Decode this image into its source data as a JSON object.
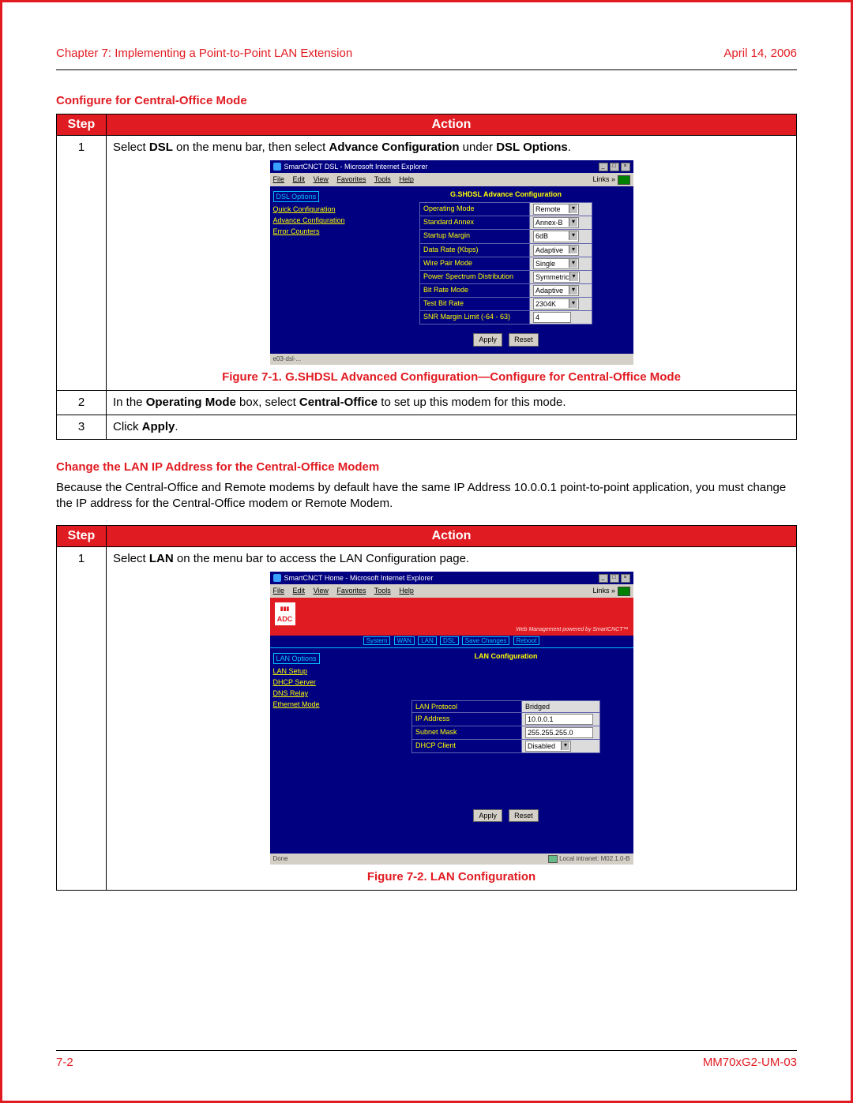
{
  "header": {
    "chapter": "Chapter 7: Implementing a Point-to-Point LAN Extension",
    "date": "April 14, 2006"
  },
  "section1": {
    "heading": "Configure for Central-Office Mode",
    "table_headers": {
      "step": "Step",
      "action": "Action"
    },
    "rows": [
      {
        "num": "1",
        "pre": "Select ",
        "b1": "DSL",
        "mid1": " on the menu bar, then select ",
        "b2": "Advance Configuration",
        "mid2": " under ",
        "b3": "DSL Options",
        "post": "."
      },
      {
        "num": "2",
        "pre": "In the ",
        "b1": "Operating Mode",
        "mid1": " box, select ",
        "b2": "Central-Office",
        "post": " to set up this modem for this mode."
      },
      {
        "num": "3",
        "pre": "Click ",
        "b1": "Apply",
        "post": "."
      }
    ],
    "figure_caption": "Figure 7-1. G.SHDSL Advanced Configuration—Configure for Central-Office Mode"
  },
  "embed1": {
    "title": "SmartCNCT DSL - Microsoft Internet Explorer",
    "menus": {
      "file": "File",
      "edit": "Edit",
      "view": "View",
      "favorites": "Favorites",
      "tools": "Tools",
      "help": "Help"
    },
    "links_label": "Links »",
    "sidebar": {
      "group": "DSL Options",
      "items": [
        "Quick Configuration",
        "Advance Configuration",
        "Error Counters"
      ]
    },
    "config_title": "G.SHDSL Advance Configuration",
    "fields": [
      {
        "label": "Operating Mode",
        "value": "Remote",
        "type": "dropdown"
      },
      {
        "label": "Standard Annex",
        "value": "Annex-B",
        "type": "dropdown"
      },
      {
        "label": "Startup Margin",
        "value": "6dB",
        "type": "dropdown"
      },
      {
        "label": "Data Rate (Kbps)",
        "value": "Adaptive",
        "type": "dropdown"
      },
      {
        "label": "Wire Pair Mode",
        "value": "Single",
        "type": "dropdown"
      },
      {
        "label": "Power Spectrum Distribution",
        "value": "Symmetric",
        "type": "dropdown"
      },
      {
        "label": "Bit Rate Mode",
        "value": "Adaptive",
        "type": "dropdown"
      },
      {
        "label": "Test Bit Rate",
        "value": "2304K",
        "type": "dropdown"
      },
      {
        "label": "SNR Margin Limit (-64 - 63)",
        "value": "4",
        "type": "text"
      }
    ],
    "buttons": {
      "apply": "Apply",
      "reset": "Reset"
    },
    "status_left": "e03-dsl-..."
  },
  "section2": {
    "heading": "Change the LAN IP Address for the Central-Office Modem",
    "body": "Because the Central-Office and Remote modems by default have the same IP Address 10.0.0.1 point-to-point application, you must change the IP address for the Central-Office modem or Remote Modem.",
    "table_headers": {
      "step": "Step",
      "action": "Action"
    },
    "rows": [
      {
        "num": "1",
        "pre": "Select ",
        "b1": "LAN",
        "post": " on the menu bar to access the LAN Configuration page."
      }
    ],
    "figure_caption": "Figure 7-2. LAN Configuration"
  },
  "embed2": {
    "title": "SmartCNCT Home - Microsoft Internet Explorer",
    "menus": {
      "file": "File",
      "edit": "Edit",
      "view": "View",
      "favorites": "Favorites",
      "tools": "Tools",
      "help": "Help"
    },
    "links_label": "Links »",
    "logo": "ADC",
    "poweredby": "Web Management powered by SmartCNCT™",
    "tabs": [
      "System",
      "WAN",
      "LAN",
      "DSL",
      "Save Changes",
      "Reboot"
    ],
    "sidebar": {
      "group": "LAN Options",
      "items": [
        "LAN Setup",
        "DHCP Server",
        "DNS Relay",
        "Ethernet Mode"
      ]
    },
    "config_title": "LAN Configuration",
    "fields": [
      {
        "label": "LAN Protocol",
        "value": "Bridged",
        "type": "static"
      },
      {
        "label": "IP Address",
        "value": "10.0.0.1",
        "type": "text"
      },
      {
        "label": "Subnet Mask",
        "value": "255.255.255.0",
        "type": "text"
      },
      {
        "label": "DHCP Client",
        "value": "Disabled",
        "type": "dropdown"
      }
    ],
    "buttons": {
      "apply": "Apply",
      "reset": "Reset"
    },
    "status_left": "Done",
    "status_right": "Local intranet: M02.1.0-B"
  },
  "footer": {
    "page": "7-2",
    "docid": "MM70xG2-UM-03"
  }
}
